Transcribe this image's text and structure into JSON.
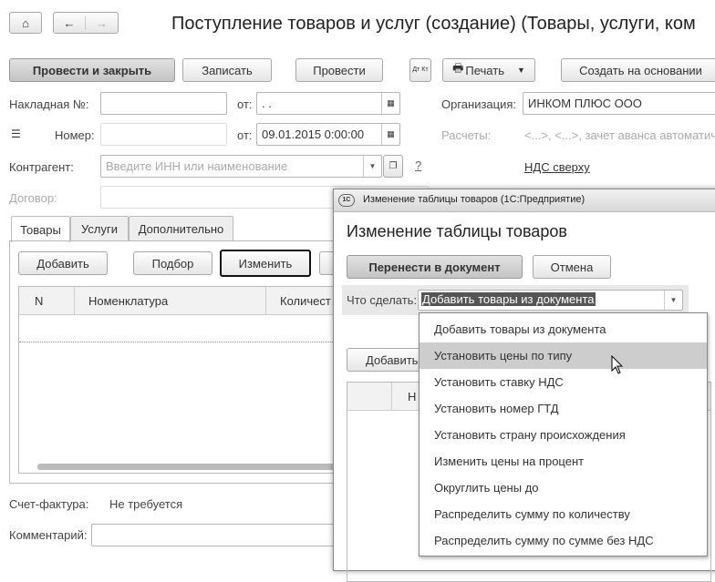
{
  "window": {
    "title": "Поступление товаров и услуг (создание) (Товары, услуги, ком"
  },
  "toolbar": {
    "post_close": "Провести и закрыть",
    "save": "Записать",
    "post": "Провести",
    "dtkt": "Дт Кт",
    "print": "Печать",
    "create_based": "Создать на основании"
  },
  "form": {
    "invoice_label": "Накладная  №:",
    "from_label": "от:",
    "invoice_date": " .  .",
    "org_label": "Организация:",
    "org_value": "ИНКОМ ПЛЮС ООО",
    "number_label": "Номер:",
    "number_date": "09.01.2015  0:00:00",
    "settlements_label": "Расчеты:",
    "settlements_value": "<...>, <...>, зачет аванса автоматич",
    "contractor_label": "Контрагент:",
    "contractor_placeholder": "Введите ИНН или наименование",
    "help": "?",
    "vat_link": "НДС сверху",
    "contract_label": "Договор:",
    "invoice_fact_label": "Счет-фактура:",
    "invoice_fact_value": "Не требуется",
    "comment_label": "Комментарий:"
  },
  "tabs": [
    {
      "label": "Товары"
    },
    {
      "label": "Услуги"
    },
    {
      "label": "Дополнительно"
    }
  ],
  "goods": {
    "add": "Добавить",
    "pick": "Подбор",
    "change": "Изменить",
    "columns": [
      "N",
      "Номенклатура",
      "Количест"
    ]
  },
  "dialog": {
    "window_title": "Изменение таблицы товаров  (1С:Предприятие)",
    "heading": "Изменение таблицы товаров",
    "transfer": "Перенести в документ",
    "cancel": "Отмена",
    "action_label": "Что сделать:",
    "action_value": "Добавить товары из документа",
    "add": "Добавить",
    "col": "Н",
    "options": [
      "Добавить товары из документа",
      "Установить цены по типу",
      "Установить ставку НДС",
      "Установить номер ГТД",
      "Установить страну происхождения",
      "Изменить цены на процент",
      "Округлить цены до",
      "Распределить сумму по количеству",
      "Распределить сумму по сумме без НДС"
    ],
    "highlighted_index": 1
  }
}
